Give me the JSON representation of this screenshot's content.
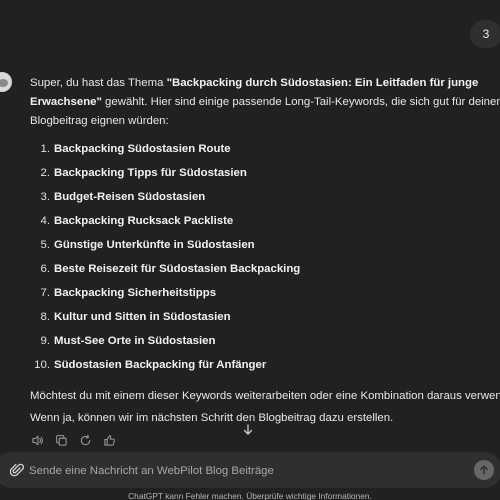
{
  "header": {
    "count_badge": "3"
  },
  "message": {
    "intro_lines": [
      {
        "pre": "Super, du hast das Thema ",
        "bold": "\"Backpacking durch Südostasien: Ein Leitfaden für junge",
        "post": ""
      },
      {
        "pre": "",
        "bold": "Erwachsene\"",
        "post": " gewählt. Hier sind einige passende Long-Tail-Keywords, die sich gut für deinen"
      },
      {
        "pre": "Blogbeitrag eignen würden:",
        "bold": "",
        "post": ""
      }
    ],
    "keywords": [
      {
        "num": "1.",
        "label": "Backpacking Südostasien Route"
      },
      {
        "num": "2.",
        "label": "Backpacking Tipps für Südostasien"
      },
      {
        "num": "3.",
        "label": "Budget-Reisen Südostasien"
      },
      {
        "num": "4.",
        "label": "Backpacking Rucksack Packliste"
      },
      {
        "num": "5.",
        "label": "Günstige Unterkünfte in Südostasien"
      },
      {
        "num": "6.",
        "label": "Beste Reisezeit für Südostasien Backpacking"
      },
      {
        "num": "7.",
        "label": "Backpacking Sicherheitstipps"
      },
      {
        "num": "8.",
        "label": "Kultur und Sitten in Südostasien"
      },
      {
        "num": "9.",
        "label": "Must-See Orte in Südostasien"
      },
      {
        "num": "10.",
        "label": "Südostasien Backpacking für Anfänger"
      }
    ],
    "outro_lines": [
      "Möchtest du mit einem dieser Keywords weiterarbeiten oder eine Kombination daraus verwenden?",
      "Wenn ja, können wir im nächsten Schritt den Blogbeitrag dazu erstellen."
    ]
  },
  "actions": {
    "icons": [
      "speaker-icon",
      "copy-icon",
      "regenerate-icon",
      "feedback-icon"
    ]
  },
  "composer": {
    "placeholder": "Sende eine Nachricht an WebPilot Blog Beiträge"
  },
  "footer": {
    "disclaimer": "ChatGPT kann Fehler machen. Überprüfe wichtige Informationen."
  }
}
